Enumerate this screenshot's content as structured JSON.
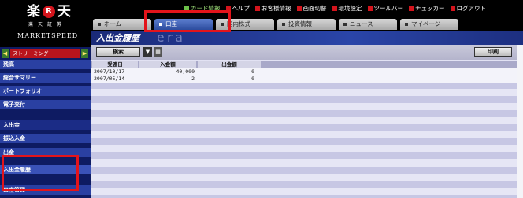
{
  "logo": {
    "mark_left": "楽",
    "mark_r": "R",
    "mark_right": "天",
    "sub": "楽天証券",
    "product": "MARKETSPEED"
  },
  "top_links": [
    {
      "label": "カード情報",
      "icon": "square-icon"
    },
    {
      "label": "ヘルプ",
      "icon": "square-icon"
    },
    {
      "label": "お客様情報",
      "icon": "square-icon"
    },
    {
      "label": "画面切替",
      "icon": "square-icon"
    },
    {
      "label": "環境設定",
      "icon": "square-icon"
    },
    {
      "label": "ツールバー",
      "icon": "square-icon"
    },
    {
      "label": "チェッカー",
      "icon": "square-icon"
    },
    {
      "label": "ログアウト",
      "icon": "square-icon"
    }
  ],
  "tabs": [
    {
      "label": "ホーム",
      "selected": false
    },
    {
      "label": "口座",
      "selected": true
    },
    {
      "label": "国内株式",
      "selected": false
    },
    {
      "label": "投資情報",
      "selected": false
    },
    {
      "label": "ニュース",
      "selected": false
    },
    {
      "label": "マイページ",
      "selected": false
    }
  ],
  "page_title": "入出金履歴",
  "title_overlay": "era",
  "sidebar": {
    "stream_label": "ストリーミング",
    "items": [
      {
        "label": "残高"
      },
      {
        "label": "総合サマリー"
      },
      {
        "label": "ポートフォリオ"
      },
      {
        "label": "電子交付"
      },
      {
        "label": "入出金"
      },
      {
        "label": "振込入金"
      },
      {
        "label": "出金"
      },
      {
        "label": "入出金履歴"
      },
      {
        "label": "口座管理"
      }
    ]
  },
  "toolbar": {
    "search_label": "検索",
    "print_label": "印刷",
    "dropdown_icon": "chevron-down-icon",
    "calendar_icon": "calendar-icon"
  },
  "table": {
    "columns": [
      "受渡日",
      "入金額",
      "出金額"
    ],
    "rows": [
      {
        "date": "2007/10/17",
        "deposit": "40,000",
        "withdrawal": "0"
      },
      {
        "date": "2007/05/14",
        "deposit": "2",
        "withdrawal": "0"
      }
    ]
  },
  "colors": {
    "highlight": "#e3141b",
    "sidebar_bg": "#0e1b62",
    "title_bar": "#1a2a78",
    "selected_tab": "#2c4c9e",
    "stripe_light": "#e6e6f5",
    "stripe_dark": "#c7c7e4"
  }
}
